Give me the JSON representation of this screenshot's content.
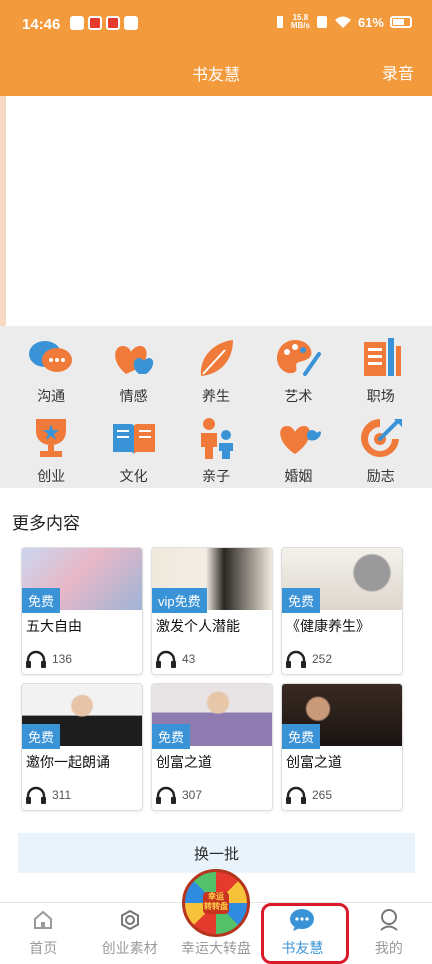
{
  "status_bar": {
    "time": "14:46",
    "speed": "15.8\nMB/s",
    "battery": "61%"
  },
  "header": {
    "title": "书友慧",
    "action": "录音"
  },
  "categories": [
    {
      "label": "沟通",
      "icon": "chat-bubbles-icon",
      "color": "#3A93D6"
    },
    {
      "label": "情感",
      "icon": "hearts-icon",
      "color": "#F07A3A"
    },
    {
      "label": "养生",
      "icon": "leaf-icon",
      "color": "#F07A3A"
    },
    {
      "label": "艺术",
      "icon": "palette-icon",
      "color": "#F07A3A"
    },
    {
      "label": "职场",
      "icon": "documents-icon",
      "color": "#F07A3A"
    },
    {
      "label": "创业",
      "icon": "trophy-icon",
      "color": "#F07A3A"
    },
    {
      "label": "文化",
      "icon": "book-icon",
      "color": "#3A93D6"
    },
    {
      "label": "亲子",
      "icon": "family-icon",
      "color": "#F07A3A"
    },
    {
      "label": "婚姻",
      "icon": "heart-icon",
      "color": "#F07A3A"
    },
    {
      "label": "励志",
      "icon": "target-icon",
      "color": "#F07A3A"
    }
  ],
  "more_content": {
    "title": "更多内容",
    "items": [
      {
        "badge": "免费",
        "title": "五大自由",
        "count": "136",
        "thumb": "woman-portrait"
      },
      {
        "badge": "vip免费",
        "title": "激发个人潜能",
        "count": "43",
        "thumb": "calligraphy"
      },
      {
        "badge": "免费",
        "title": "《健康养生》",
        "count": "252",
        "thumb": "ink-painting"
      },
      {
        "badge": "免费",
        "title": "邀你一起朗诵",
        "count": "311",
        "thumb": "woman-suit"
      },
      {
        "badge": "免费",
        "title": "创富之道",
        "count": "307",
        "thumb": "woman-purple"
      },
      {
        "badge": "免费",
        "title": "创富之道",
        "count": "265",
        "thumb": "man-stage"
      }
    ],
    "refresh_label": "换一批"
  },
  "tabs": [
    {
      "label": "首页",
      "icon": "home-icon"
    },
    {
      "label": "创业素材",
      "icon": "hexagon-icon"
    },
    {
      "label": "幸运大转盘",
      "icon": "lucky-wheel-icon"
    },
    {
      "label": "书友慧",
      "icon": "chat-bubble-icon",
      "active": true
    },
    {
      "label": "我的",
      "icon": "user-icon"
    }
  ],
  "wheel_text": "幸运\n转转盘"
}
